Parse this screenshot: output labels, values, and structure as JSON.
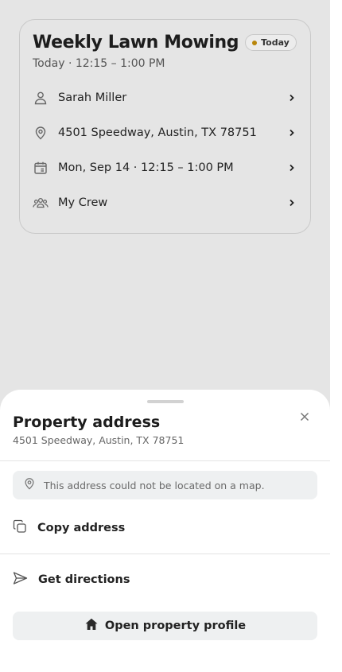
{
  "job": {
    "title": "Weekly Lawn Mowing",
    "badge": "Today",
    "time": "Today · 12:15 – 1:00 PM",
    "rows": [
      {
        "icon": "person-icon",
        "label": "Sarah Miller"
      },
      {
        "icon": "location-pin-icon",
        "label": "4501 Speedway, Austin, TX 78751"
      },
      {
        "icon": "calendar-icon",
        "label": "Mon, Sep 14 · 12:15 – 1:00 PM"
      },
      {
        "icon": "crew-icon",
        "label": "My Crew"
      }
    ]
  },
  "sheet": {
    "title": "Property address",
    "address": "4501 Speedway, Austin, TX 78751",
    "notice": "This address could not be located on a map.",
    "copy_label": "Copy address",
    "directions_label": "Get directions",
    "profile_label": "Open property profile"
  },
  "colors": {
    "backdrop": "#e5e5e5",
    "badge_dot": "#b8860b",
    "muted_fill": "#eef0f1"
  }
}
